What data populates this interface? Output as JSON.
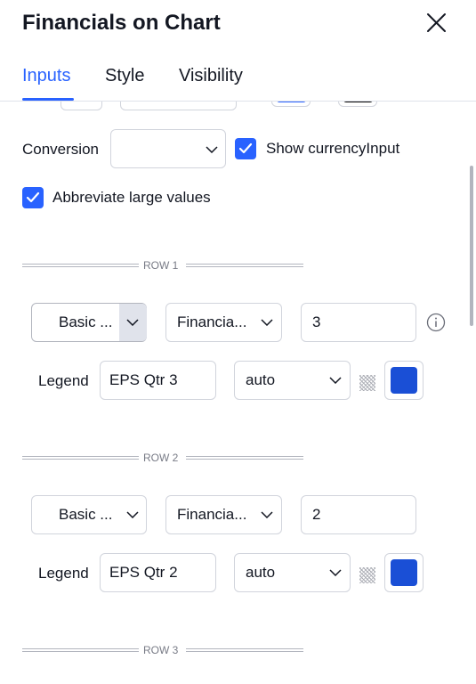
{
  "dialog": {
    "title": "Financials on Chart"
  },
  "tabs": [
    {
      "label": "Inputs",
      "active": true
    },
    {
      "label": "Style",
      "active": false
    },
    {
      "label": "Visibility",
      "active": false
    }
  ],
  "top_row": {
    "color_a": "#2962ff",
    "color_b": "#000000"
  },
  "conversion": {
    "label": "Conversion",
    "value": ""
  },
  "show_currency": {
    "label": "Show currencyInput",
    "checked": true
  },
  "abbreviate": {
    "label": "Abbreviate large values",
    "checked": true
  },
  "rows": [
    {
      "separator": "ROW 1",
      "category": "Basic ...",
      "metric": "Financia...",
      "value": "3",
      "legend_label": "Legend",
      "legend_value": "EPS Qtr 3",
      "style": "auto",
      "color": "#1a4fd6"
    },
    {
      "separator": "ROW 2",
      "category": "Basic ...",
      "metric": "Financia...",
      "value": "2",
      "legend_label": "Legend",
      "legend_value": "EPS Qtr 2",
      "style": "auto",
      "color": "#1a4fd6"
    },
    {
      "separator": "ROW 3"
    }
  ],
  "colors": {
    "accent": "#2962ff",
    "text": "#131722",
    "border": "#d1d4dc"
  }
}
